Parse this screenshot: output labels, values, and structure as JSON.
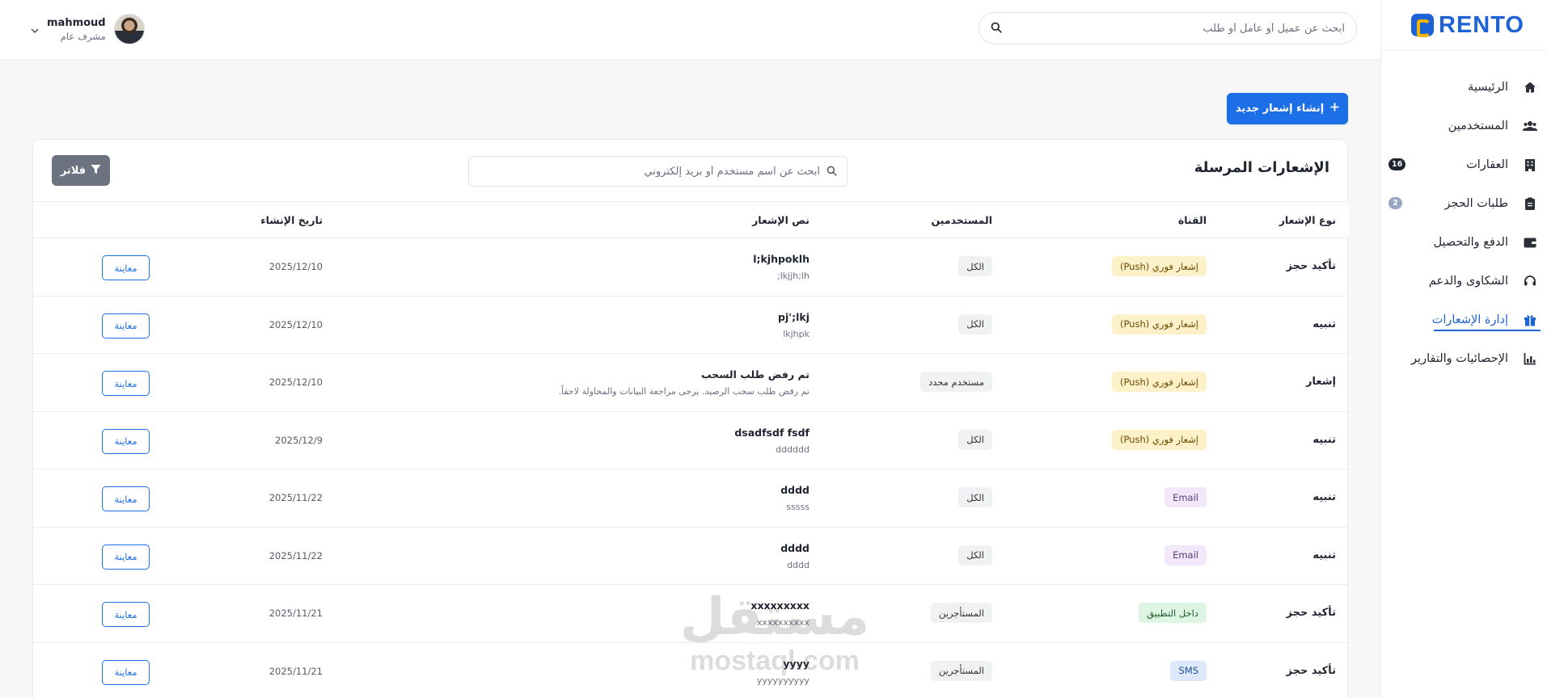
{
  "brand": {
    "name": "RENTO",
    "primary_color": "#1d6fe8"
  },
  "header": {
    "search_placeholder": "ابحث عن عميل أو عامل أو طلب",
    "user": {
      "name": "mahmoud",
      "role": "مشرف عام"
    }
  },
  "sidebar": {
    "items": [
      {
        "label": "الرئيسية",
        "icon": "home-icon"
      },
      {
        "label": "المستخدمين",
        "icon": "users-icon"
      },
      {
        "label": "العقارات",
        "icon": "building-icon",
        "badge": "16"
      },
      {
        "label": "طلبات الحجز",
        "icon": "clipboard-icon",
        "badge": "2"
      },
      {
        "label": "الدفع والتحصيل",
        "icon": "wallet-icon"
      },
      {
        "label": "الشكاوى والدعم",
        "icon": "headset-icon"
      },
      {
        "label": "إدارة الإشعارات",
        "icon": "gift-icon",
        "active": true
      },
      {
        "label": "الإحصائيات والتقارير",
        "icon": "chart-icon"
      }
    ]
  },
  "actions": {
    "create_label": "إنشاء إشعار جديد"
  },
  "notifications": {
    "title": "الإشعارات المرسلة",
    "search_placeholder": "ابحث عن اسم مستخدم أو بريد إلكتروني",
    "filter_label": "فلاتر",
    "columns": {
      "type": "نوع الإشعار",
      "channel": "القناة",
      "audience": "المستخدمين",
      "text": "نص الإشعار",
      "created": "تاريخ الإنشاء"
    },
    "view_label": "معاينة",
    "rows": [
      {
        "type": "تأكيد حجز",
        "channel": "إشعار فوري (Push)",
        "channel_kind": "push",
        "audience": "الكل",
        "title": "l;kjhpoklh",
        "body": "lkjjh;lh;",
        "date": "2025/12/10"
      },
      {
        "type": "تنبيه",
        "channel": "إشعار فوري (Push)",
        "channel_kind": "push",
        "audience": "الكل",
        "title": "pj';lkj",
        "body": "lkjhpk",
        "date": "2025/12/10"
      },
      {
        "type": "إشعار",
        "channel": "إشعار فوري (Push)",
        "channel_kind": "push",
        "audience": "مستخدم محدد",
        "title": "تم رفض طلب السحب",
        "body": "تم رفض طلب سحب الرصيد. يرجى مراجعة البيانات والمحاولة لاحقاً.",
        "date": "2025/12/10"
      },
      {
        "type": "تنبيه",
        "channel": "إشعار فوري (Push)",
        "channel_kind": "push",
        "audience": "الكل",
        "title": "dsadfsdf fsdf",
        "body": "dddddd",
        "date": "2025/12/9"
      },
      {
        "type": "تنبيه",
        "channel": "Email",
        "channel_kind": "email",
        "audience": "الكل",
        "title": "dddd",
        "body": "sssss",
        "date": "2025/11/22"
      },
      {
        "type": "تنبيه",
        "channel": "Email",
        "channel_kind": "email",
        "audience": "الكل",
        "title": "dddd",
        "body": "dddd",
        "date": "2025/11/22"
      },
      {
        "type": "تأكيد حجز",
        "channel": "داخل التطبيق",
        "channel_kind": "app",
        "audience": "المستأجرين",
        "title": "xxxxxxxxx",
        "body": "xxxxxxxxxx",
        "date": "2025/11/21"
      },
      {
        "type": "تأكيد حجز",
        "channel": "SMS",
        "channel_kind": "sms",
        "audience": "المستأجرين",
        "title": "yyyy",
        "body": "yyyyyyyyyy",
        "date": "2025/11/21"
      }
    ]
  },
  "watermark": {
    "arabic": "مستقل",
    "latin": "mostaql.com"
  }
}
